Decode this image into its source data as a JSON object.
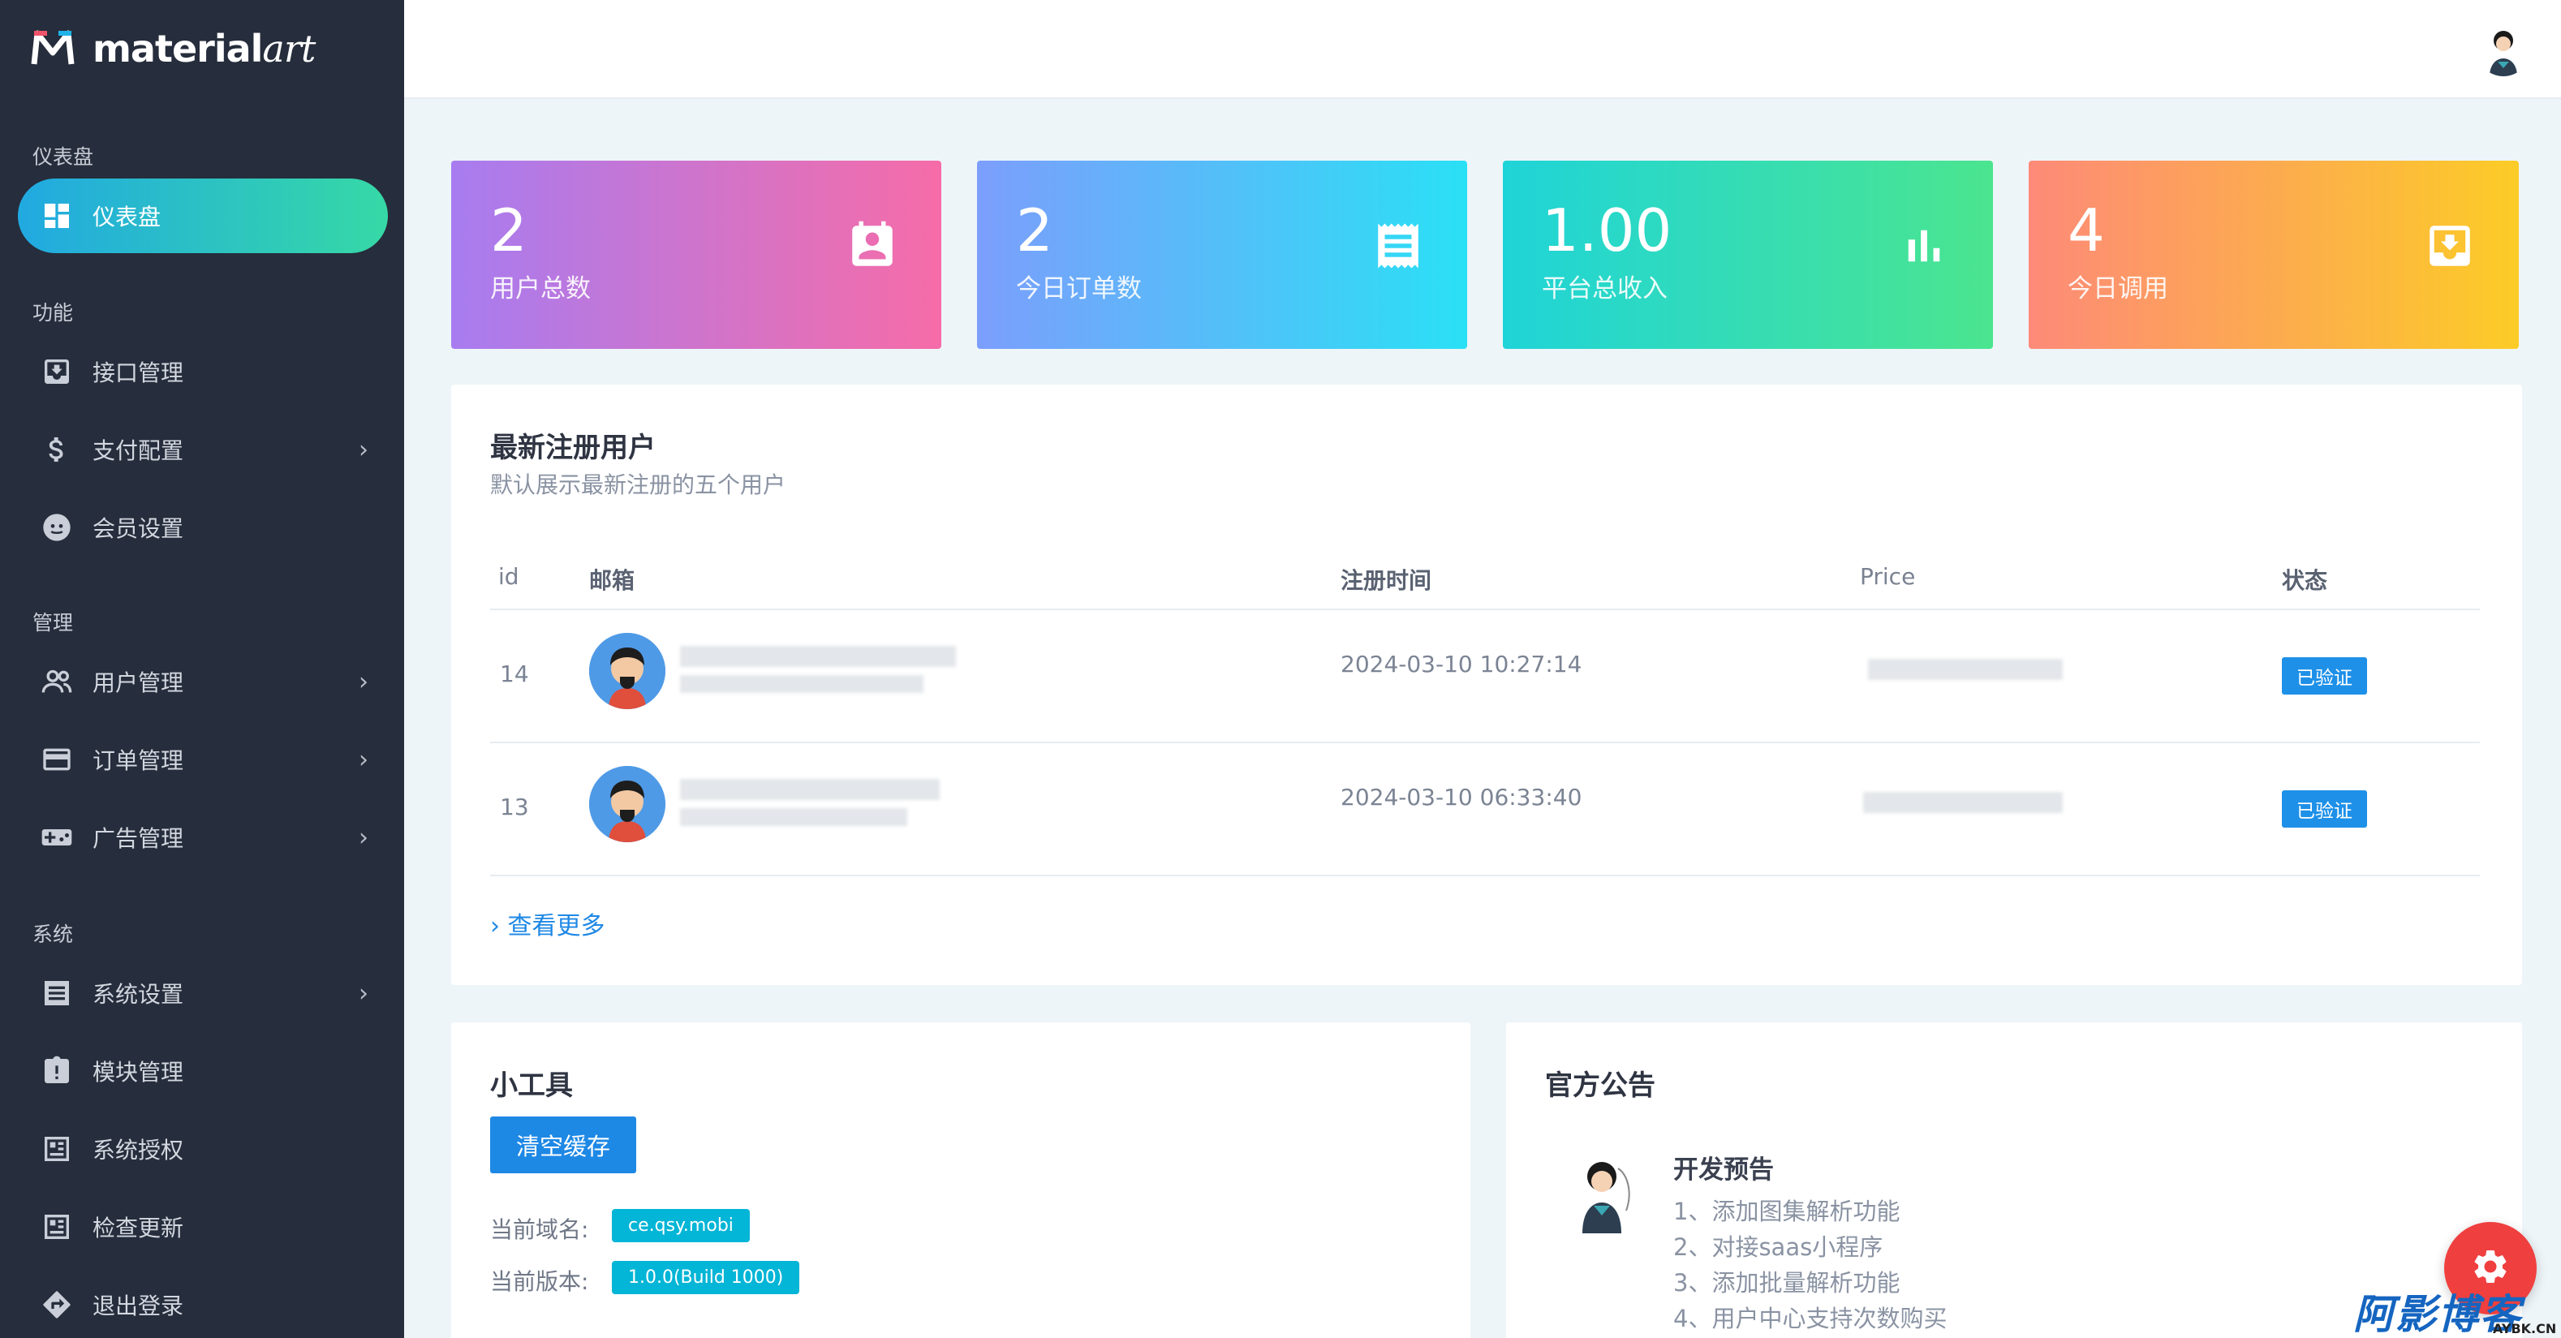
{
  "brand": {
    "name_bold": "material",
    "name_script": "art"
  },
  "sidebar": {
    "sections": [
      "仪表盘",
      "功能",
      "管理",
      "系统"
    ],
    "items": [
      {
        "label": "仪表盘",
        "icon": "dashboard-icon",
        "active": true
      },
      {
        "label": "接口管理",
        "icon": "inbox-icon"
      },
      {
        "label": "支付配置",
        "icon": "dollar-icon",
        "has_children": true
      },
      {
        "label": "会员设置",
        "icon": "face-icon"
      },
      {
        "label": "用户管理",
        "icon": "users-icon",
        "has_children": true
      },
      {
        "label": "订单管理",
        "icon": "credit-card-icon",
        "has_children": true
      },
      {
        "label": "广告管理",
        "icon": "gamepad-icon",
        "has_children": true
      },
      {
        "label": "系统设置",
        "icon": "list-icon",
        "has_children": true
      },
      {
        "label": "模块管理",
        "icon": "clipboard-alert-icon"
      },
      {
        "label": "系统授权",
        "icon": "newspaper-icon"
      },
      {
        "label": "检查更新",
        "icon": "newspaper-icon"
      },
      {
        "label": "退出登录",
        "icon": "exit-icon"
      }
    ]
  },
  "stats": [
    {
      "value": "2",
      "label": "用户总数",
      "icon": "account-box-icon",
      "colors": [
        "#a77cf0",
        "#f66ca8"
      ]
    },
    {
      "value": "2",
      "label": "今日订单数",
      "icon": "receipt-icon",
      "colors": [
        "#7c9efc",
        "#2ae0f5"
      ]
    },
    {
      "value": "1.00",
      "label": "平台总收入",
      "icon": "bar-chart-icon",
      "colors": [
        "#1fd4d8",
        "#4be58f"
      ]
    },
    {
      "value": "4",
      "label": "今日调用",
      "icon": "inbox-download-icon",
      "colors": [
        "#fd8a78",
        "#fccc26"
      ]
    }
  ],
  "users_panel": {
    "title": "最新注册用户",
    "subtitle": "默认展示最新注册的五个用户",
    "columns": [
      "id",
      "邮箱",
      "注册时间",
      "Price",
      "状态"
    ],
    "rows": [
      {
        "id": "14",
        "registered": "2024-03-10 10:27:14",
        "status": "已验证"
      },
      {
        "id": "13",
        "registered": "2024-03-10 06:33:40",
        "status": "已验证"
      }
    ],
    "more_link": "查看更多"
  },
  "tools_panel": {
    "title": "小工具",
    "clear_cache_button": "清空缓存",
    "domain_label": "当前域名:",
    "domain_value": "ce.qsy.mobi",
    "version_label": "当前版本:",
    "version_value": "1.0.0(Build 1000)"
  },
  "notice_panel": {
    "title": "官方公告",
    "notice_title": "开发预告",
    "lines": [
      "1、添加图集解析功能",
      "2、对接saas小程序",
      "3、添加批量解析功能",
      "4、用户中心支持次数购买"
    ]
  },
  "watermark": {
    "text": "阿影博客",
    "sub": "AYBK.CN"
  },
  "colors": {
    "sidebar_bg": "#262d3c",
    "page_bg": "#eef5f9",
    "accent": "#1e88e5",
    "active_gradient": [
      "#21a9e1",
      "#36d9a6"
    ]
  }
}
